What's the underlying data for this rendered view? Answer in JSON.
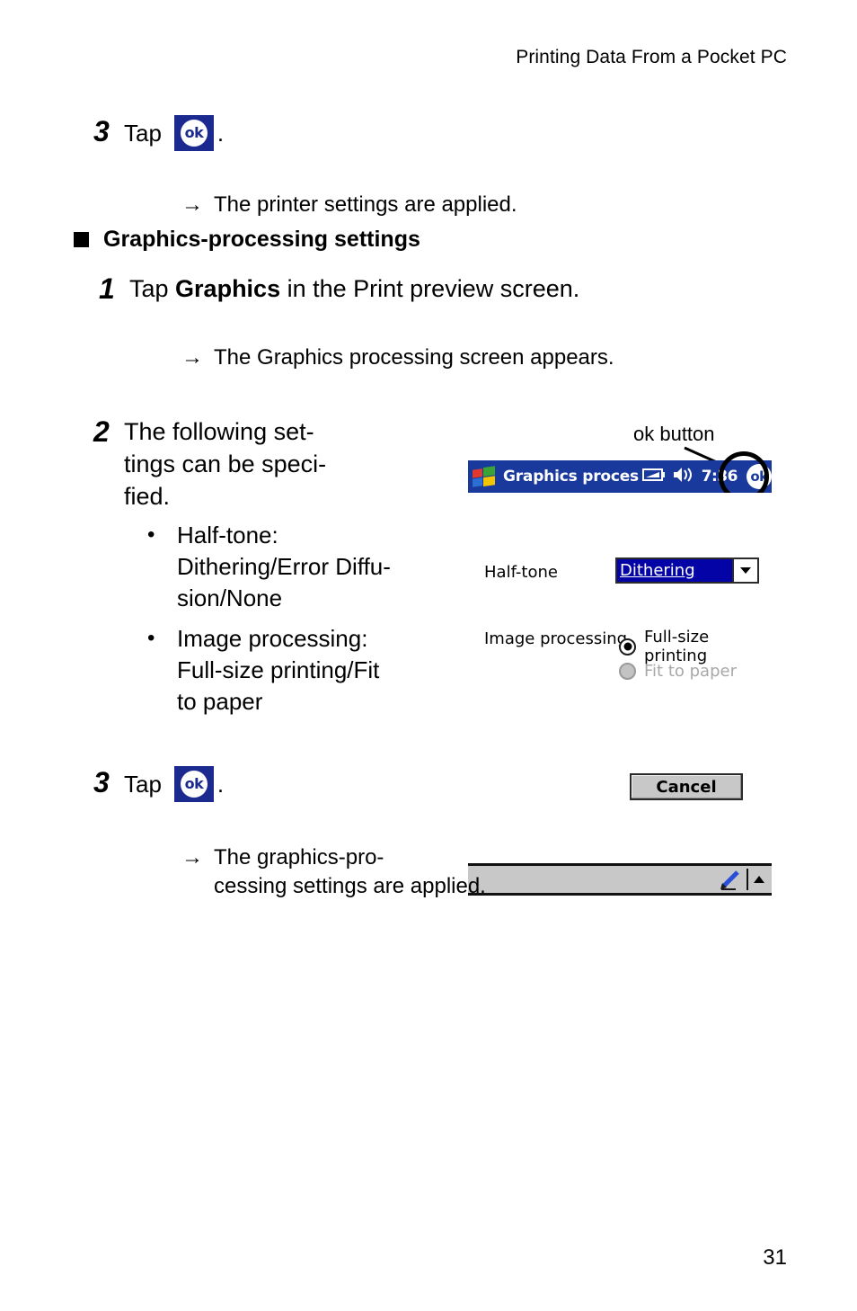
{
  "header": {
    "running_title": "Printing Data From a Pocket PC"
  },
  "steps": {
    "step3_top": {
      "number": "3",
      "verb": "Tap",
      "icon": "ok-button-icon",
      "trailing": ".",
      "result_arrow": "→",
      "result_text": "The printer settings are applied."
    },
    "section_heading": "Graphics-processing settings",
    "step1": {
      "number": "1",
      "text_before": "Tap ",
      "bold_word": "Graphics",
      "text_after": " in the Print preview screen.",
      "result_arrow": "→",
      "result_text": "The Graphics processing screen appears."
    },
    "step2": {
      "number": "2",
      "text": "The following set-\ntings can be speci-\nfied.",
      "bullets": [
        "Half-tone:\nDithering/Error Diffu-\nsion/None",
        "Image processing:\nFull-size printing/Fit\nto paper"
      ]
    },
    "step3_bottom": {
      "number": "3",
      "verb": "Tap",
      "icon": "ok-button-icon",
      "trailing": ".",
      "result_arrow": "→",
      "result_text": "The graphics-pro-\ncessing settings are applied."
    }
  },
  "callout": {
    "label": "ok button"
  },
  "pda": {
    "titlebar": {
      "start_icon": "windows-flag-icon",
      "title": "Graphics processinɡ",
      "battery_icon": "battery-icon",
      "volume_icon": "speaker-icon",
      "clock": "7:36",
      "ok_label": "ok"
    },
    "form": {
      "halftone_label": "Half-tone",
      "halftone_value": "Dithering",
      "image_processing_label": "Image processing",
      "radio_options": [
        {
          "label": "Full-size printing",
          "selected": true,
          "disabled": false
        },
        {
          "label": "Fit to paper",
          "selected": false,
          "disabled": true
        }
      ],
      "cancel_label": "Cancel"
    },
    "softbar": {
      "pencil_icon": "stylus-pencil-icon",
      "up_icon": "caret-up-icon"
    }
  },
  "footer": {
    "page_number": "31"
  },
  "colors": {
    "titlebar_blue": "#19399c",
    "ok_chip_blue": "#1a2a8e",
    "combo_select_blue": "#0404a6",
    "button_gray": "#c8c8c8",
    "disabled_gray": "#a8a8a8"
  }
}
